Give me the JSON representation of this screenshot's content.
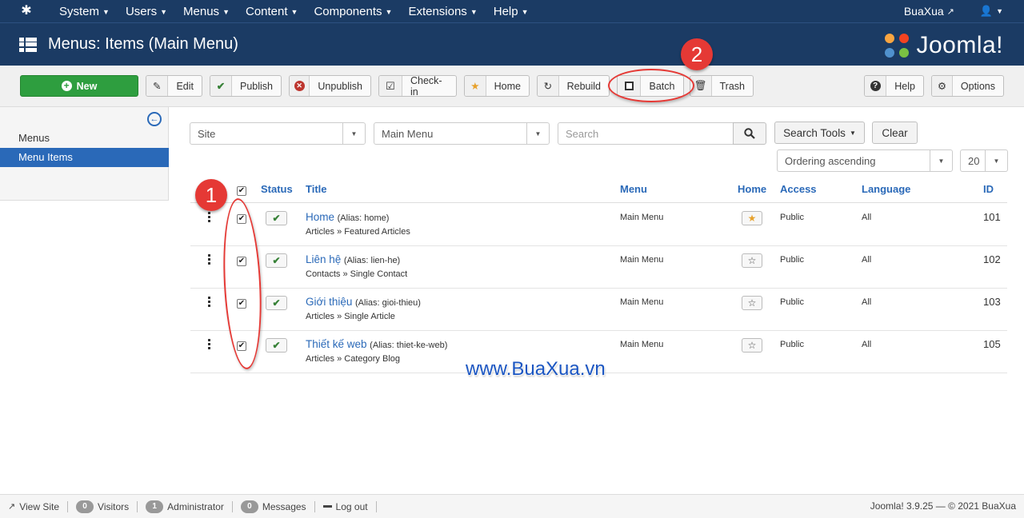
{
  "topnav": {
    "menus": [
      "System",
      "Users",
      "Menus",
      "Content",
      "Components",
      "Extensions",
      "Help"
    ],
    "site_name": "BuaXua"
  },
  "header": {
    "title": "Menus: Items (Main Menu)",
    "brand": "Joomla!"
  },
  "toolbar": {
    "new": "New",
    "edit": "Edit",
    "publish": "Publish",
    "unpublish": "Unpublish",
    "checkin": "Check-in",
    "home": "Home",
    "rebuild": "Rebuild",
    "batch": "Batch",
    "trash": "Trash",
    "help": "Help",
    "options": "Options"
  },
  "sidebar": {
    "items": [
      "Menus",
      "Menu Items"
    ]
  },
  "filters": {
    "client": "Site",
    "menu": "Main Menu",
    "search_placeholder": "Search",
    "search_tools": "Search Tools",
    "clear": "Clear",
    "ordering": "Ordering ascending",
    "limit": "20"
  },
  "table": {
    "headers": {
      "status": "Status",
      "title": "Title",
      "menu": "Menu",
      "home": "Home",
      "access": "Access",
      "language": "Language",
      "id": "ID"
    },
    "rows": [
      {
        "title": "Home",
        "alias": "(Alias: home)",
        "type": "Articles » Featured Articles",
        "menu": "Main Menu",
        "home": true,
        "access": "Public",
        "language": "All",
        "id": "101"
      },
      {
        "title": "Liên hệ",
        "alias": "(Alias: lien-he)",
        "type": "Contacts » Single Contact",
        "menu": "Main Menu",
        "home": false,
        "access": "Public",
        "language": "All",
        "id": "102"
      },
      {
        "title": "Giới thiệu",
        "alias": "(Alias: gioi-thieu)",
        "type": "Articles » Single Article",
        "menu": "Main Menu",
        "home": false,
        "access": "Public",
        "language": "All",
        "id": "103"
      },
      {
        "title": "Thiết kế web",
        "alias": "(Alias: thiet-ke-web)",
        "type": "Articles » Category Blog",
        "menu": "Main Menu",
        "home": false,
        "access": "Public",
        "language": "All",
        "id": "105"
      }
    ]
  },
  "annotations": {
    "step1": "1",
    "step2": "2",
    "watermark": "www.BuaXua.vn",
    "accent": "#e53935"
  },
  "statusbar": {
    "view_site": "View Site",
    "visitors_count": "0",
    "visitors": "Visitors",
    "admin_count": "1",
    "admin": "Administrator",
    "messages_count": "0",
    "messages": "Messages",
    "logout": "Log out",
    "version": "Joomla! 3.9.25 — © 2021 BuaXua"
  },
  "colors": {
    "navbar": "#1b3b64",
    "link": "#2a69b8",
    "new_button": "#2e9e3f"
  }
}
